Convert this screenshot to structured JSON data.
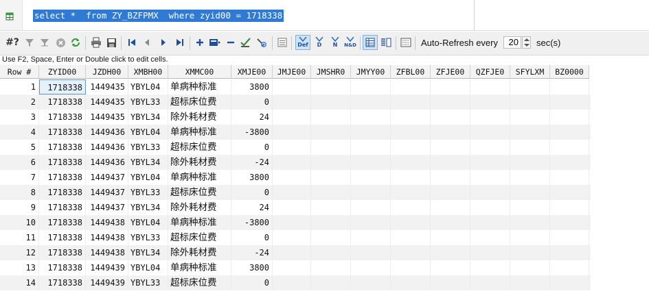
{
  "editor": {
    "sql": "select *  from ZY_BZFPMX  where zyid00 = 1718338"
  },
  "toolbar": {
    "query_by_example": "#?",
    "def_label": "Def",
    "d_label": "D",
    "n_label": "N",
    "nd_label": "N&D",
    "auto_refresh_label": "Auto-Refresh every",
    "auto_refresh_value": "20",
    "auto_refresh_unit": "sec(s)"
  },
  "hint": "Use F2, Space, Enter or Double click to edit cells.",
  "grid": {
    "columns": [
      "Row #",
      "ZYID00",
      "JZDH00",
      "XMBH00",
      "XMMC00",
      "XMJE00",
      "JMJE00",
      "JMSHR0",
      "JMYY00",
      "ZFBL00",
      "ZFJE00",
      "QZFJE0",
      "SFYLXM",
      "BZ0000"
    ],
    "rows": [
      {
        "n": "1",
        "zyid": "1718338",
        "jzdh": "1449435",
        "xmbh": "YBYL04",
        "xmmc": "单病种标准",
        "xmje": "3800"
      },
      {
        "n": "2",
        "zyid": "1718338",
        "jzdh": "1449435",
        "xmbh": "YBYL33",
        "xmmc": "超标床位费",
        "xmje": "0"
      },
      {
        "n": "3",
        "zyid": "1718338",
        "jzdh": "1449435",
        "xmbh": "YBYL34",
        "xmmc": "除外耗材费",
        "xmje": "24"
      },
      {
        "n": "4",
        "zyid": "1718338",
        "jzdh": "1449436",
        "xmbh": "YBYL04",
        "xmmc": "单病种标准",
        "xmje": "-3800"
      },
      {
        "n": "5",
        "zyid": "1718338",
        "jzdh": "1449436",
        "xmbh": "YBYL33",
        "xmmc": "超标床位费",
        "xmje": "0"
      },
      {
        "n": "6",
        "zyid": "1718338",
        "jzdh": "1449436",
        "xmbh": "YBYL34",
        "xmmc": "除外耗材费",
        "xmje": "-24"
      },
      {
        "n": "7",
        "zyid": "1718338",
        "jzdh": "1449437",
        "xmbh": "YBYL04",
        "xmmc": "单病种标准",
        "xmje": "3800"
      },
      {
        "n": "8",
        "zyid": "1718338",
        "jzdh": "1449437",
        "xmbh": "YBYL33",
        "xmmc": "超标床位费",
        "xmje": "0"
      },
      {
        "n": "9",
        "zyid": "1718338",
        "jzdh": "1449437",
        "xmbh": "YBYL34",
        "xmmc": "除外耗材费",
        "xmje": "24"
      },
      {
        "n": "10",
        "zyid": "1718338",
        "jzdh": "1449438",
        "xmbh": "YBYL04",
        "xmmc": "单病种标准",
        "xmje": "-3800"
      },
      {
        "n": "11",
        "zyid": "1718338",
        "jzdh": "1449438",
        "xmbh": "YBYL33",
        "xmmc": "超标床位费",
        "xmje": "0"
      },
      {
        "n": "12",
        "zyid": "1718338",
        "jzdh": "1449438",
        "xmbh": "YBYL34",
        "xmmc": "除外耗材费",
        "xmje": "-24"
      },
      {
        "n": "13",
        "zyid": "1718338",
        "jzdh": "1449439",
        "xmbh": "YBYL04",
        "xmmc": "单病种标准",
        "xmje": "3800"
      },
      {
        "n": "14",
        "zyid": "1718338",
        "jzdh": "1449439",
        "xmbh": "YBYL33",
        "xmmc": "超标床位费",
        "xmje": "0"
      }
    ]
  },
  "colors": {
    "selection": "#2f7ad4",
    "row_alt": "#f2f2f2",
    "header_bg": "#f3f3f3"
  }
}
